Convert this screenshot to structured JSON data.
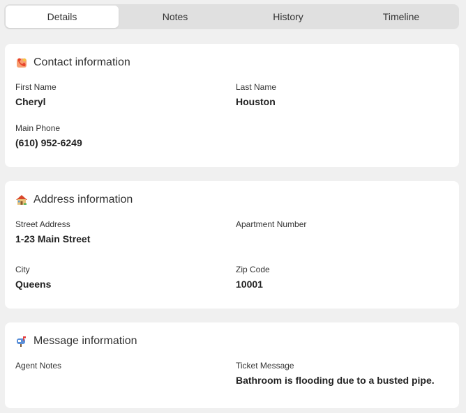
{
  "tabs": [
    {
      "label": "Details",
      "active": true
    },
    {
      "label": "Notes",
      "active": false
    },
    {
      "label": "History",
      "active": false
    },
    {
      "label": "Timeline",
      "active": false
    }
  ],
  "contact": {
    "title": "Contact information",
    "icon": "phone-handset-icon",
    "first_name_label": "First Name",
    "first_name": "Cheryl",
    "last_name_label": "Last Name",
    "last_name": "Houston",
    "phone_label": "Main Phone",
    "phone": "(610) 952-6249"
  },
  "address": {
    "title": "Address information",
    "icon": "house-icon",
    "street_label": "Street Address",
    "street": "1-23 Main Street",
    "apt_label": "Apartment Number",
    "apt": "",
    "city_label": "City",
    "city": "Queens",
    "zip_label": "Zip Code",
    "zip": "10001"
  },
  "message": {
    "title": "Message information",
    "icon": "mailbox-icon",
    "agent_notes_label": "Agent Notes",
    "agent_notes": "",
    "ticket_label": "Ticket Message",
    "ticket": "Bathroom is flooding due to a busted pipe."
  }
}
